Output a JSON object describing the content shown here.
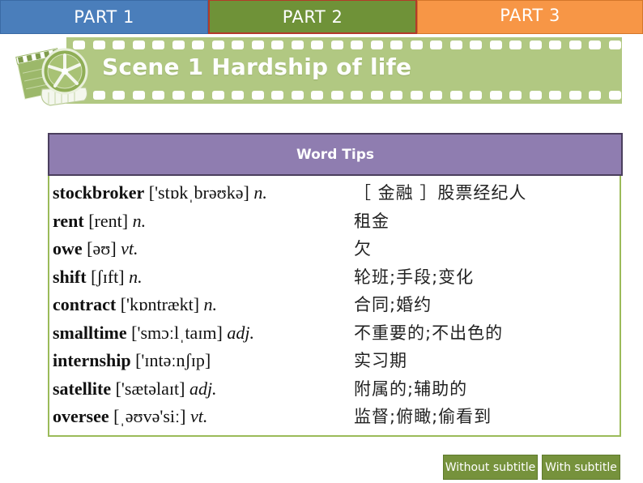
{
  "tabs": [
    {
      "label": "PART 1",
      "color": "#4a7ebb"
    },
    {
      "label": "PART 2",
      "color": "#6f9238"
    },
    {
      "label": "PART 3",
      "color": "#f79646"
    }
  ],
  "banner": {
    "title": "Scene 1 Hardship of life",
    "icon": "film-clapperboard-icon",
    "color": "#b1c882"
  },
  "word_tips": {
    "title": "Word Tips",
    "header_color": "#8f7db0",
    "entries": [
      {
        "word": "stockbroker",
        "phonetic": "['stɒkˌbrəʊkə]",
        "pos": "n.",
        "meaning": "［ 金融 ］股票经纪人"
      },
      {
        "word": "rent",
        "phonetic": "[rent]",
        "pos": "n.",
        "meaning": "租金"
      },
      {
        "word": "owe",
        "phonetic": "[əʊ]",
        "pos": "vt.",
        "meaning": "欠"
      },
      {
        "word": "shift",
        "phonetic": "[ʃɪft]",
        "pos": "n.",
        "meaning": "轮班;手段;变化"
      },
      {
        "word": "contract",
        "phonetic": "['kɒntrækt]",
        "pos": "n.",
        "meaning": "合同;婚约"
      },
      {
        "word": "smalltime",
        "phonetic": "['smɔːlˌtaɪm]",
        "pos": "adj.",
        "meaning": "不重要的;不出色的"
      },
      {
        "word": "internship",
        "phonetic": "['ɪntəːnʃɪp]",
        "pos": "",
        "meaning": "实习期"
      },
      {
        "word": "satellite",
        "phonetic": "['sætəlaɪt]",
        "pos": "adj.",
        "meaning": "附属的;辅助的"
      },
      {
        "word": "oversee",
        "phonetic": "[ˌəʊvə'siː]",
        "pos": "vt.",
        "meaning": "监督;俯瞰;偷看到"
      }
    ]
  },
  "buttons": {
    "without_subtitle": "Without subtitle",
    "with_subtitle": "With subtitle",
    "color": "#76923c"
  }
}
